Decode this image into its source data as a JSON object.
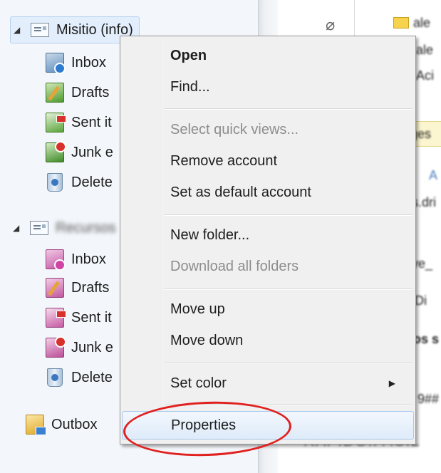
{
  "folder_pane": {
    "accounts": [
      {
        "name": "Misitio (info)",
        "selected": true,
        "folders": [
          {
            "label": "Inbox",
            "icon": "inbox-icon"
          },
          {
            "label": "Drafts",
            "icon": "drafts-icon"
          },
          {
            "label": "Sent it",
            "icon": "sent-items-icon"
          },
          {
            "label": "Junk e",
            "icon": "junk-email-icon"
          },
          {
            "label": "Delete",
            "icon": "deleted-items-icon"
          }
        ]
      },
      {
        "name": "Recursos",
        "selected": false,
        "folders": [
          {
            "label": "Inbox",
            "icon": "inbox-icon"
          },
          {
            "label": "Drafts",
            "icon": "drafts-icon"
          },
          {
            "label": "Sent it",
            "icon": "sent-items-icon"
          },
          {
            "label": "Junk e",
            "icon": "junk-email-icon"
          },
          {
            "label": "Delete",
            "icon": "deleted-items-icon"
          }
        ]
      }
    ],
    "outbox_label": "Outbox"
  },
  "message_pane": {
    "peek_lines": [
      "ale",
      "ale",
      "Aci",
      "ges",
      "A",
      "s.dri",
      "ve_",
      "Di",
      "os s",
      "9##"
    ],
    "bottom_text": "RAPIDO.FACIL"
  },
  "context_menu": {
    "items": [
      {
        "label": "Open",
        "bold": true,
        "enabled": true
      },
      {
        "label": "Find...",
        "enabled": true
      },
      {
        "label": "Select quick views...",
        "enabled": false
      },
      {
        "label": "Remove account",
        "enabled": true
      },
      {
        "label": "Set as default account",
        "enabled": true
      },
      {
        "label": "New folder...",
        "enabled": true
      },
      {
        "label": "Download all folders",
        "enabled": false
      },
      {
        "label": "Move up",
        "enabled": true
      },
      {
        "label": "Move down",
        "enabled": true
      },
      {
        "label": "Set color",
        "enabled": true,
        "has_submenu": true
      },
      {
        "label": "Properties",
        "enabled": true,
        "highlighted": true
      }
    ]
  },
  "annotation": {
    "highlight_color": "#e0201e"
  }
}
